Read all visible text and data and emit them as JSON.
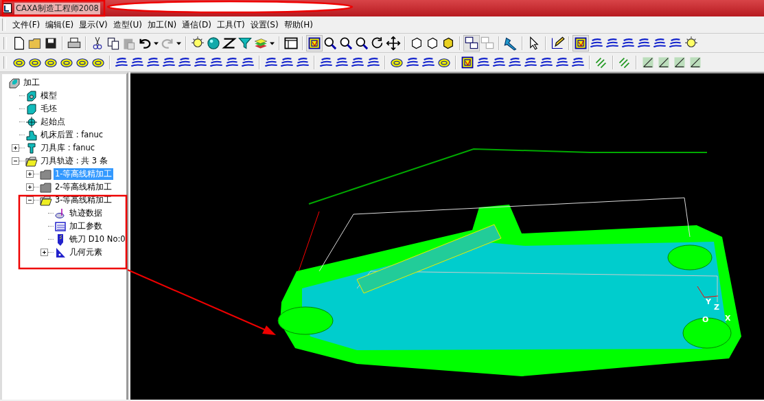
{
  "window": {
    "title": "CAXA制造工程师2008"
  },
  "menu": [
    {
      "label": "文件(F)"
    },
    {
      "label": "编辑(E)"
    },
    {
      "label": "显示(V)"
    },
    {
      "label": "造型(U)"
    },
    {
      "label": "加工(N)"
    },
    {
      "label": "通信(D)"
    },
    {
      "label": "工具(T)"
    },
    {
      "label": "设置(S)"
    },
    {
      "label": "帮助(H)"
    }
  ],
  "tree": {
    "label": "加工",
    "kind": "root",
    "selected": false,
    "children": [
      {
        "label": "模型",
        "kind": "model",
        "selected": false
      },
      {
        "label": "毛坯",
        "kind": "stock",
        "selected": false
      },
      {
        "label": "起始点",
        "kind": "start",
        "selected": false
      },
      {
        "label": "机床后置 : fanuc",
        "kind": "machine",
        "selected": false
      },
      {
        "label": "刀具库 : fanuc",
        "kind": "toollib",
        "selected": false,
        "expanded": false
      },
      {
        "label": "刀具轨迹 : 共 3 条",
        "kind": "folder",
        "selected": false,
        "expanded": true,
        "children": [
          {
            "label": "1-等高线精加工",
            "kind": "folder",
            "selected": true,
            "expanded": false
          },
          {
            "label": "2-等高线精加工",
            "kind": "folder",
            "selected": false,
            "expanded": false
          },
          {
            "label": "3-等高线精加工",
            "kind": "folder",
            "selected": false,
            "expanded": true,
            "children": [
              {
                "label": "轨迹数据",
                "kind": "pathdata",
                "selected": false
              },
              {
                "label": "加工参数",
                "kind": "params",
                "selected": false
              },
              {
                "label": "铣刀 D10 No:0",
                "kind": "cutter",
                "selected": false
              },
              {
                "label": "几何元素",
                "kind": "geometry",
                "selected": false,
                "expanded": false
              }
            ]
          }
        ]
      }
    ]
  },
  "viewport": {
    "axis_labels": [
      "Y",
      "Z",
      "O",
      "X"
    ]
  }
}
